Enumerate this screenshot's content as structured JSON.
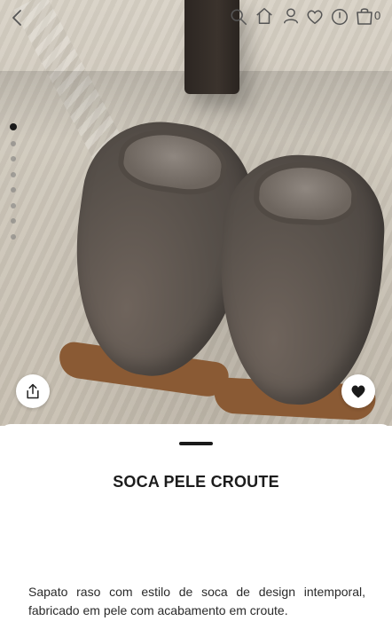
{
  "topbar": {
    "cart_count": "0"
  },
  "gallery": {
    "image_count": 8,
    "active_index": 0
  },
  "product": {
    "title": "SOCA PELE CROUTE",
    "description": "Sapato raso com estilo de soca de design intemporal, fabricado em pele com acabamento em croute."
  },
  "colors": {
    "accent": "#1a1a1a",
    "sheet_bg": "#ffffff"
  },
  "icons": {
    "back": "back-icon",
    "search": "search-icon",
    "home": "home-icon",
    "account": "user-icon",
    "wishlist": "heart-icon",
    "help": "circle-icon",
    "cart": "bag-icon",
    "share": "share-icon",
    "favorite": "heart-filled-icon"
  }
}
